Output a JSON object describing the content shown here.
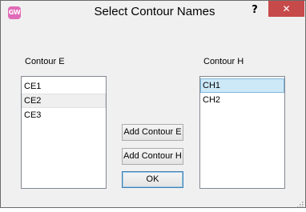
{
  "window": {
    "title": "Select Contour Names",
    "app_icon_text": "GW",
    "help_label": "?",
    "close_label": "✕"
  },
  "left_panel": {
    "label": "Contour E",
    "items": [
      "CE1",
      "CE2",
      "CE3"
    ],
    "hover_index": 1
  },
  "right_panel": {
    "label": "Contour H",
    "items": [
      "CH1",
      "CH2"
    ],
    "selected_index": 0
  },
  "buttons": {
    "add_e": "Add Contour E",
    "add_h": "Add Contour H",
    "ok": "OK"
  },
  "colors": {
    "close_bg": "#c74a4a",
    "selection_bg": "#cde8f7",
    "selection_border": "#7fb6da"
  },
  "icons": {
    "app": "gw-app-icon",
    "help": "help-icon",
    "close": "close-icon",
    "grip": "resize-grip-icon"
  }
}
